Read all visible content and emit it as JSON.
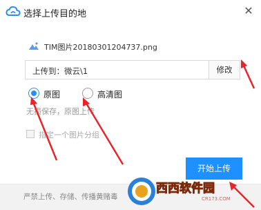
{
  "window": {
    "title": "选择上传目的地",
    "close_icon": "close-icon",
    "logo_icon": "cloud-icon"
  },
  "file": {
    "icon": "image-file-icon",
    "name": "TIM图片20180301204737.png"
  },
  "destination": {
    "text": "上传到：微云\\1",
    "edit_label": "修改"
  },
  "quality": {
    "options": [
      {
        "label": "原图",
        "selected": true
      },
      {
        "label": "高清图",
        "selected": false
      }
    ],
    "hint": "无损保存，原图上传"
  },
  "group": {
    "label": "指定一个图片分组",
    "checked": false
  },
  "actions": {
    "start_label": "开始上传"
  },
  "footer": {
    "text": "严禁上传、存储、传播黄赌毒"
  },
  "watermark": {
    "logo_text": "西西软件园",
    "domain": "CR173.COM"
  },
  "colors": {
    "accent": "#1e90ff",
    "radio_selected": "#2a8ef0",
    "annotation_arrow": "#e8242a"
  }
}
